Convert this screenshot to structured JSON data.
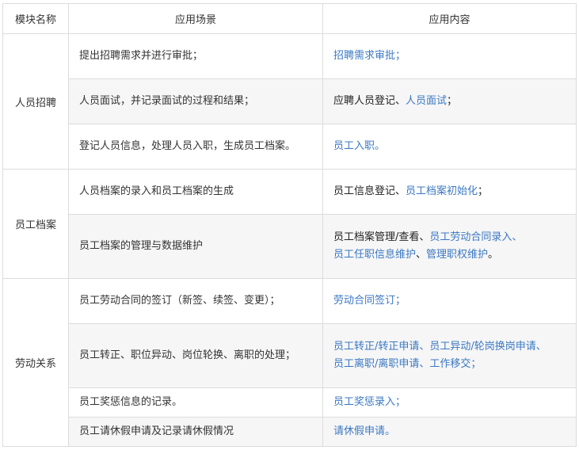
{
  "header": {
    "col_module": "模块名称",
    "col_scene": "应用场景",
    "col_content": "应用内容"
  },
  "groups": [
    {
      "module": "人员招聘",
      "rows": [
        {
          "scene": "提出招聘需求并进行审批；",
          "content": [
            [
              {
                "t": "招聘需求审批",
                "link": true
              },
              {
                "t": "；",
                "link": true
              }
            ]
          ]
        },
        {
          "scene": "人员面试，并记录面试的过程和结果；",
          "content": [
            [
              {
                "t": "应聘人员登记",
                "link": false
              },
              {
                "t": "、",
                "link": false
              },
              {
                "t": "人员面试",
                "link": true
              },
              {
                "t": "；",
                "link": false
              }
            ]
          ]
        },
        {
          "scene": "登记人员信息，处理人员入职，生成员工档案。",
          "content": [
            [
              {
                "t": "员工入职",
                "link": true
              },
              {
                "t": "。",
                "link": true
              }
            ]
          ]
        }
      ]
    },
    {
      "module": "员工档案",
      "rows": [
        {
          "scene": "人员档案的录入和员工档案的生成",
          "content": [
            [
              {
                "t": "员工信息登记",
                "link": false
              },
              {
                "t": "、",
                "link": false
              },
              {
                "t": "员工档案初始化",
                "link": true
              },
              {
                "t": "；",
                "link": false
              }
            ]
          ]
        },
        {
          "scene": "员工档案的管理与数据维护",
          "content": [
            [
              {
                "t": "员工档案管理/查看",
                "link": false
              },
              {
                "t": "、",
                "link": false
              },
              {
                "t": "员工劳动合同录入",
                "link": true
              },
              {
                "t": "、",
                "link": true
              }
            ],
            [
              {
                "t": "员工任职信息维护",
                "link": true
              },
              {
                "t": "、",
                "link": false
              },
              {
                "t": "管理职权维护",
                "link": true
              },
              {
                "t": "。",
                "link": false
              }
            ]
          ]
        }
      ]
    },
    {
      "module": "劳动关系",
      "rows": [
        {
          "scene": "员工劳动合同的签订（新签、续签、变更）；",
          "content": [
            [
              {
                "t": "劳动合同签订",
                "link": true
              },
              {
                "t": "；",
                "link": true
              }
            ]
          ]
        },
        {
          "scene": "员工转正、职位异动、岗位轮换、离职的处理；",
          "content": [
            [
              {
                "t": "员工转正/转正申请",
                "link": true
              },
              {
                "t": "、",
                "link": true
              },
              {
                "t": "员工异动/轮岗换岗申请",
                "link": true
              },
              {
                "t": "、",
                "link": true
              }
            ],
            [
              {
                "t": "员工离职/离职申请",
                "link": true
              },
              {
                "t": "、",
                "link": true
              },
              {
                "t": "工作移交",
                "link": true
              },
              {
                "t": "；",
                "link": true
              }
            ]
          ]
        },
        {
          "scene": "员工奖惩信息的记录。",
          "content": [
            [
              {
                "t": "员工奖惩录入",
                "link": true
              },
              {
                "t": "；",
                "link": true
              }
            ]
          ]
        },
        {
          "scene": "员工请休假申请及记录请休假情况",
          "content": [
            [
              {
                "t": "请休假申请",
                "link": true
              },
              {
                "t": "。",
                "link": true
              }
            ]
          ]
        }
      ]
    }
  ]
}
